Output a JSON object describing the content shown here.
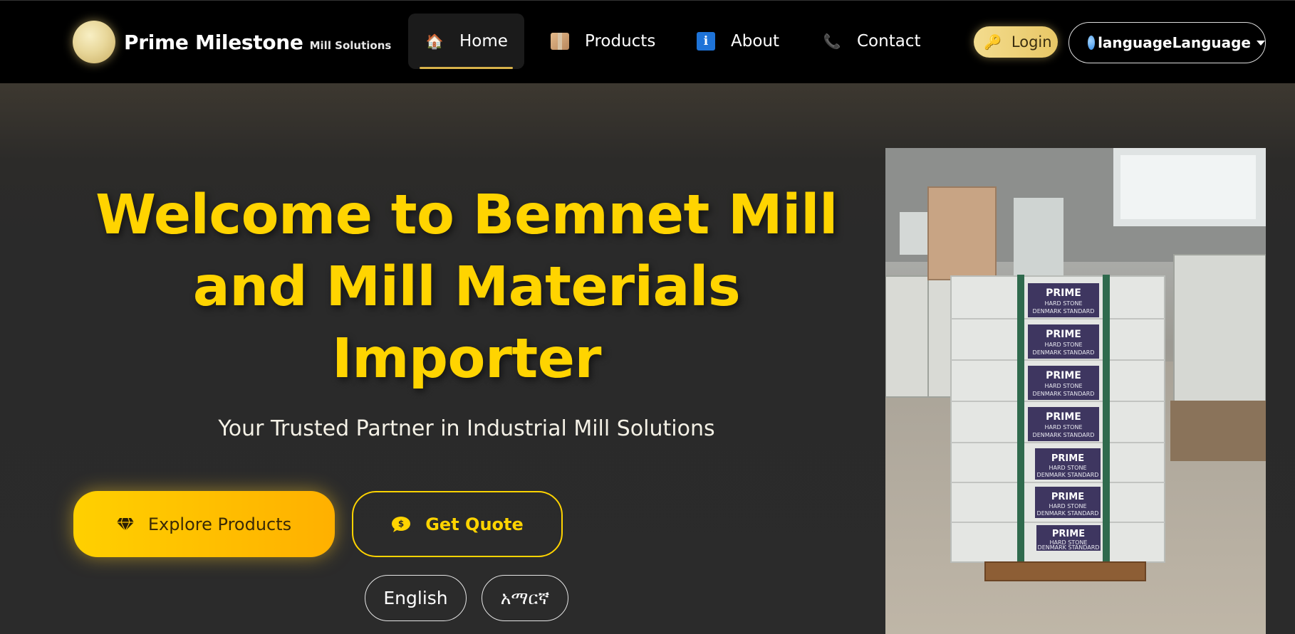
{
  "brand": {
    "name": "Prime Milestone",
    "sub": "Mill Solutions"
  },
  "nav": {
    "items": [
      {
        "label": "Home",
        "icon": "house-icon"
      },
      {
        "label": "Products",
        "icon": "package-icon"
      },
      {
        "label": "About",
        "icon": "info-icon"
      },
      {
        "label": "Contact",
        "icon": "phone-icon"
      }
    ],
    "login_label": "Login",
    "language_label": "languageLanguage"
  },
  "hero": {
    "title": "Welcome to Bemnet Mill and Mill Materials Importer",
    "subtitle": "Your Trusted Partner in Industrial Mill Solutions",
    "explore_label": "Explore Products",
    "quote_label": "Get Quote",
    "lang_english": "English",
    "lang_amharic": "አማርኛ"
  },
  "photo": {
    "box_label": "PRIME",
    "box_line2": "HARD STONE",
    "box_line3": "DENMARK STANDARD"
  },
  "colors": {
    "accent_yellow": "#ffd400",
    "navbar_bg": "#000000",
    "hero_bg": "#2a2a2a"
  }
}
